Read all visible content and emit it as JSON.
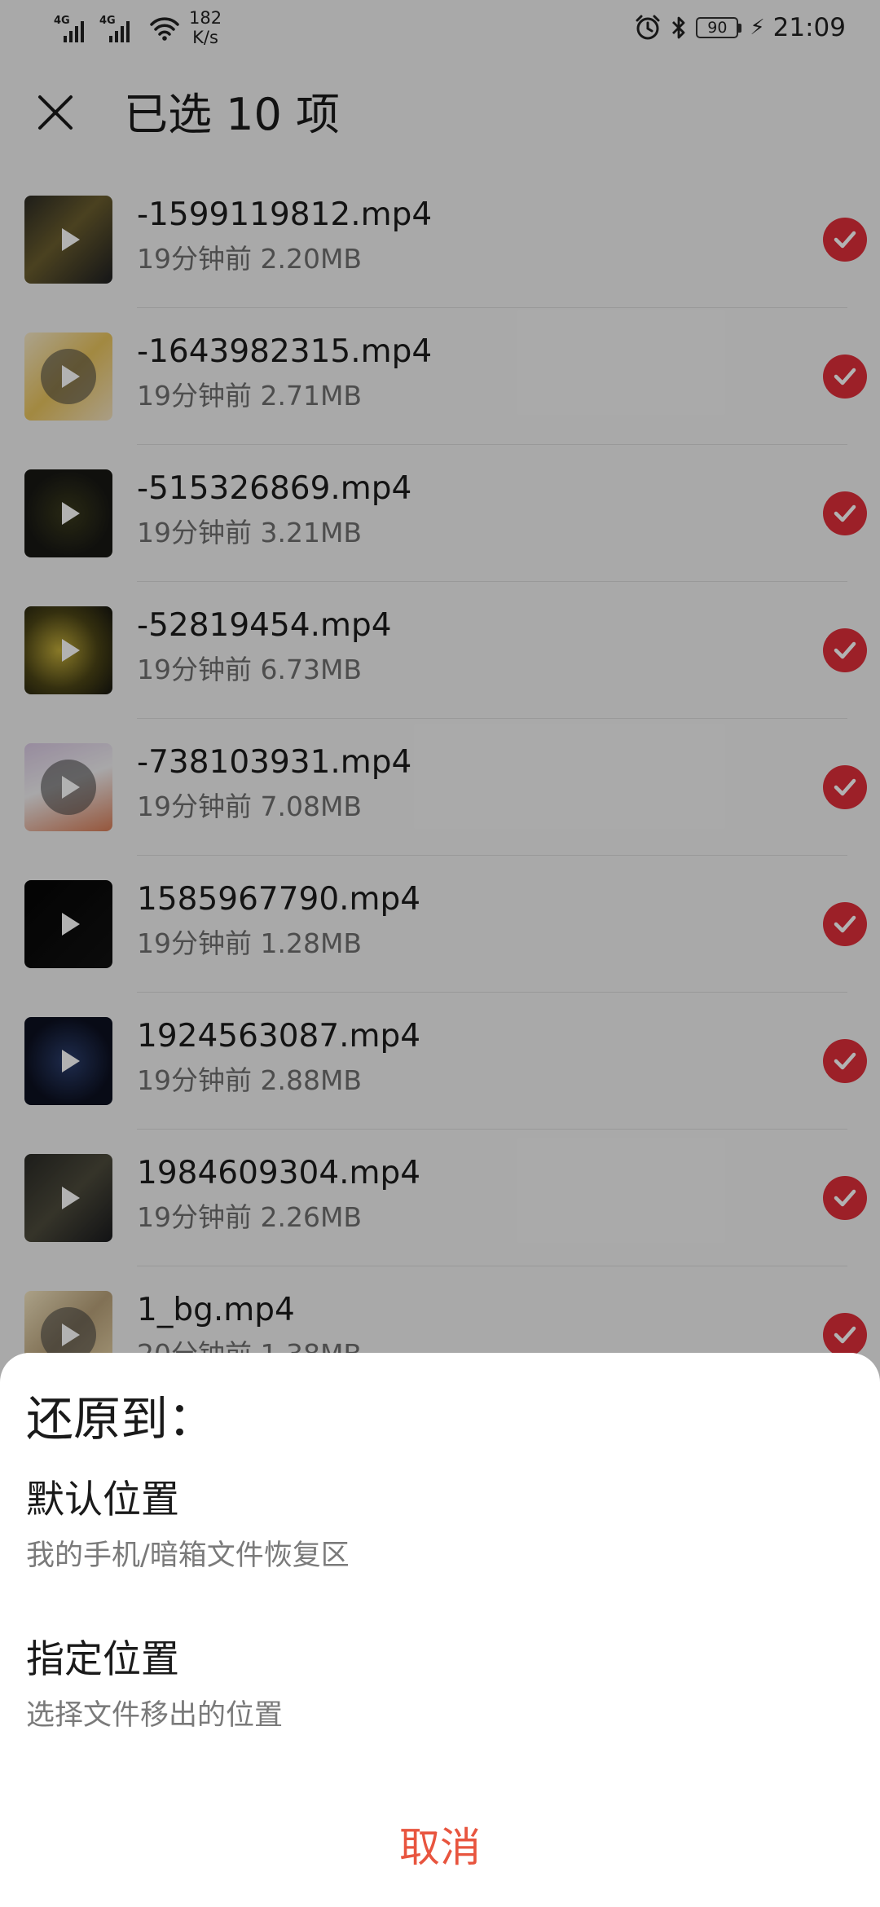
{
  "status_bar": {
    "net1": "4G",
    "net2": "4G",
    "speed_value": "182",
    "speed_unit": "K/s",
    "battery": "90",
    "time": "21:09"
  },
  "header": {
    "title": "已选 10 项"
  },
  "files": [
    {
      "name": "-1599119812.mp4",
      "meta": "19分钟前 2.20MB",
      "thumb": "linear-gradient(135deg,#2c2b25 0%,#6b5e2e 45%,#1e1f22 100%)",
      "play_circle": false
    },
    {
      "name": "-1643982315.mp4",
      "meta": "19分钟前 2.71MB",
      "thumb": "linear-gradient(135deg,#f6e9c9 0%,#e9c45d 50%,#f3e2c0 100%)",
      "play_circle": true
    },
    {
      "name": "-515326869.mp4",
      "meta": "19分钟前 3.21MB",
      "thumb": "radial-gradient(circle at 50% 50%,#3a3a1c 0%,#171714 70%)",
      "play_circle": false
    },
    {
      "name": "-52819454.mp4",
      "meta": "19分钟前 6.73MB",
      "thumb": "radial-gradient(circle at 40% 50%,#c4ae3a 0%,#4c4516 55%,#151510 100%)",
      "play_circle": false
    },
    {
      "name": "-738103931.mp4",
      "meta": "19分钟前 7.08MB",
      "thumb": "linear-gradient(160deg,#d9c8e3 0%,#f1f0f2 45%,#d77c56 100%)",
      "play_circle": true
    },
    {
      "name": "1585967790.mp4",
      "meta": "19分钟前 1.28MB",
      "thumb": "linear-gradient(135deg,#050505 0%,#111 100%)",
      "play_circle": false
    },
    {
      "name": "1924563087.mp4",
      "meta": "19分钟前 2.88MB",
      "thumb": "radial-gradient(circle at 50% 50%,#2b3e6d 0%,#0c1020 70%)",
      "play_circle": false
    },
    {
      "name": "1984609304.mp4",
      "meta": "19分钟前 2.26MB",
      "thumb": "linear-gradient(135deg,#2a2a26 0%,#4d4b3c 50%,#1a1b1e 100%)",
      "play_circle": false
    },
    {
      "name": "1_bg.mp4",
      "meta": "20分钟前 1.38MB",
      "thumb": "linear-gradient(135deg,#f4e6c2 0%,#b9a27a 50%,#ecd9ae 100%)",
      "play_circle": true
    }
  ],
  "sheet": {
    "title": "还原到：",
    "options": [
      {
        "title": "默认位置",
        "subtitle": "我的手机/暗箱文件恢复区"
      },
      {
        "title": "指定位置",
        "subtitle": "选择文件移出的位置"
      }
    ],
    "cancel": "取消"
  },
  "colors": {
    "accent_red": "#e02f3a",
    "cancel_orange": "#e8553f"
  },
  "icons": [
    "signal-icon",
    "wifi-icon",
    "alarm-icon",
    "bluetooth-icon",
    "battery-icon",
    "charging-icon",
    "close-icon",
    "play-icon",
    "check-icon"
  ]
}
